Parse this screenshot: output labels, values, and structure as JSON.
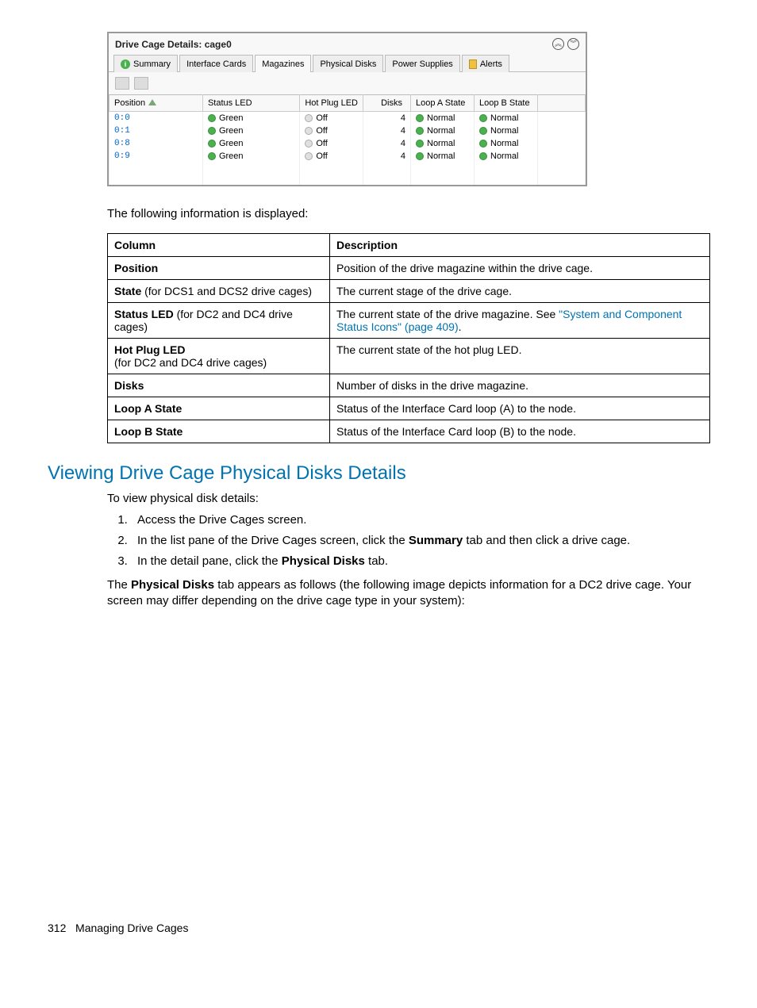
{
  "panel": {
    "title": "Drive Cage Details: cage0",
    "tabs": {
      "summary": "Summary",
      "interface": "Interface Cards",
      "magazines": "Magazines",
      "physical": "Physical Disks",
      "power": "Power Supplies",
      "alerts": "Alerts"
    },
    "headers": {
      "position": "Position",
      "status_led": "Status LED",
      "hot_plug_led": "Hot Plug LED",
      "disks": "Disks",
      "loop_a": "Loop A State",
      "loop_b": "Loop B State"
    },
    "rows": [
      {
        "position": "0:0",
        "status_led": "Green",
        "hot_plug": "Off",
        "disks": "4",
        "loop_a": "Normal",
        "loop_b": "Normal"
      },
      {
        "position": "0:1",
        "status_led": "Green",
        "hot_plug": "Off",
        "disks": "4",
        "loop_a": "Normal",
        "loop_b": "Normal"
      },
      {
        "position": "0:8",
        "status_led": "Green",
        "hot_plug": "Off",
        "disks": "4",
        "loop_a": "Normal",
        "loop_b": "Normal"
      },
      {
        "position": "0:9",
        "status_led": "Green",
        "hot_plug": "Off",
        "disks": "4",
        "loop_a": "Normal",
        "loop_b": "Normal"
      }
    ]
  },
  "intro_line": "The following information is displayed:",
  "def_table": {
    "h1": "Column",
    "h2": "Description",
    "rows": {
      "position": {
        "c": "Position",
        "d": "Position of the drive magazine within the drive cage."
      },
      "state": {
        "c_bold": "State",
        "c_rest": " (for DCS1 and DCS2 drive cages)",
        "d": "The current stage of the drive cage."
      },
      "status_led": {
        "c_bold": "Status LED",
        "c_rest": " (for DC2 and DC4 drive cages)",
        "d1": "The current state of the drive magazine. See ",
        "link": "\"System and Component Status Icons\" (page 409)",
        "d3": "."
      },
      "hot_plug": {
        "c_bold": "Hot Plug LED",
        "c_rest_line2": "(for DC2 and DC4 drive cages)",
        "d": "The current state of the hot plug LED."
      },
      "disks": {
        "c": "Disks",
        "d": "Number of disks in the drive magazine."
      },
      "loop_a": {
        "c": "Loop A State",
        "d": "Status of the Interface Card loop (A) to the node."
      },
      "loop_b": {
        "c": "Loop B State",
        "d": "Status of the Interface Card loop (B) to the node."
      }
    }
  },
  "section_heading": "Viewing Drive Cage Physical Disks Details",
  "section_intro": "To view physical disk details:",
  "steps": {
    "s1": "Access the Drive Cages screen.",
    "s2a": "In the list pane of the Drive Cages screen, click the ",
    "s2b": "Summary",
    "s2c": " tab and then click a drive cage.",
    "s3a": "In the detail pane, click the ",
    "s3b": "Physical Disks",
    "s3c": " tab."
  },
  "closing": {
    "p1a": "The ",
    "p1b": "Physical Disks",
    "p1c": " tab appears as follows (the following image depicts information for a DC2 drive cage. Your screen may differ depending on the drive cage type in your system):"
  },
  "footer": {
    "page": "312",
    "label": "Managing Drive Cages"
  }
}
